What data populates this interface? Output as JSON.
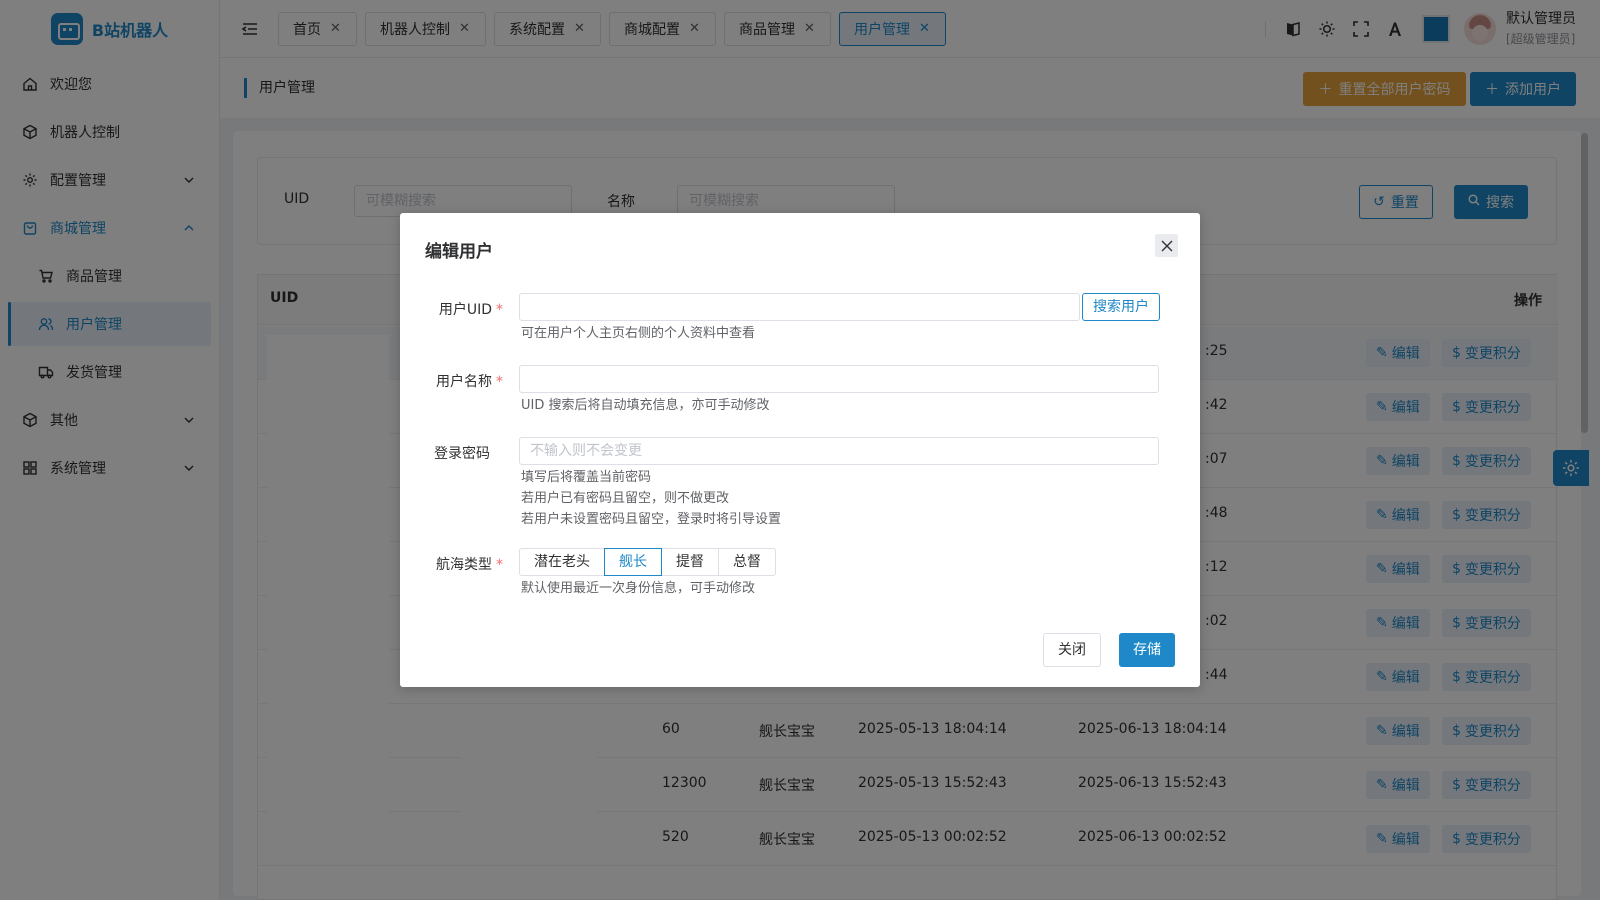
{
  "app": {
    "name": "B站机器人"
  },
  "sidebar": {
    "items": [
      {
        "label": "欢迎您"
      },
      {
        "label": "机器人控制"
      },
      {
        "label": "配置管理"
      },
      {
        "label": "商城管理"
      },
      {
        "label": "商品管理"
      },
      {
        "label": "用户管理"
      },
      {
        "label": "发货管理"
      },
      {
        "label": "其他"
      },
      {
        "label": "系统管理"
      }
    ]
  },
  "tabs": [
    {
      "label": "首页"
    },
    {
      "label": "机器人控制"
    },
    {
      "label": "系统配置"
    },
    {
      "label": "商城配置"
    },
    {
      "label": "商品管理"
    },
    {
      "label": "用户管理",
      "active": true
    }
  ],
  "user": {
    "name": "默认管理员",
    "role": "[超级管理员]"
  },
  "theme": {
    "accent": "#1e88c8",
    "warning": "#e6a23c",
    "swatch": "#1779b7"
  },
  "page": {
    "title": "用户管理",
    "reset_all_label": "重置全部用户密码",
    "add_user_label": "添加用户"
  },
  "search": {
    "uid_label": "UID",
    "uid_placeholder": "可模糊搜索",
    "name_label": "名称",
    "name_placeholder": "可模糊搜索",
    "reset_label": "重置",
    "search_label": "搜索"
  },
  "table": {
    "headers": {
      "uid": "UID",
      "actions": "操作"
    },
    "edit_label": "编辑",
    "points_label": "变更积分",
    "partial_rows": [
      {
        "end_tail": ":25"
      },
      {
        "end_tail": ":42"
      },
      {
        "end_tail": ":07"
      },
      {
        "end_tail": ":48"
      },
      {
        "end_tail": ":12"
      },
      {
        "end_tail": ":02"
      },
      {
        "end_tail": ":44"
      }
    ],
    "rows": [
      {
        "points": "60",
        "type": "舰长宝宝",
        "start": "2025-05-13 18:04:14",
        "end": "2025-06-13 18:04:14"
      },
      {
        "points": "12300",
        "type": "舰长宝宝",
        "start": "2025-05-13 15:52:43",
        "end": "2025-06-13 15:52:43"
      },
      {
        "points": "520",
        "type": "舰长宝宝",
        "start": "2025-05-13 00:02:52",
        "end": "2025-06-13 00:02:52"
      }
    ]
  },
  "dialog": {
    "title": "编辑用户",
    "uid_label": "用户UID",
    "uid_value": "",
    "uid_search_button": "搜索用户",
    "uid_hint": "可在用户个人主页右侧的个人资料中查看",
    "name_label": "用户名称",
    "name_value": "",
    "name_hint": "UID 搜索后将自动填充信息，亦可手动修改",
    "password_label": "登录密码",
    "password_placeholder": "不输入则不会变更",
    "password_hints": [
      "填写后将覆盖当前密码",
      "若用户已有密码且留空，则不做更改",
      "若用户未设置密码且留空，登录时将引导设置"
    ],
    "voyage_label": "航海类型",
    "voyage_options": [
      "潜在老头",
      "舰长",
      "提督",
      "总督"
    ],
    "voyage_selected": "舰长",
    "voyage_hint": "默认使用最近一次身份信息，可手动修改",
    "close_label": "关闭",
    "save_label": "存储"
  }
}
